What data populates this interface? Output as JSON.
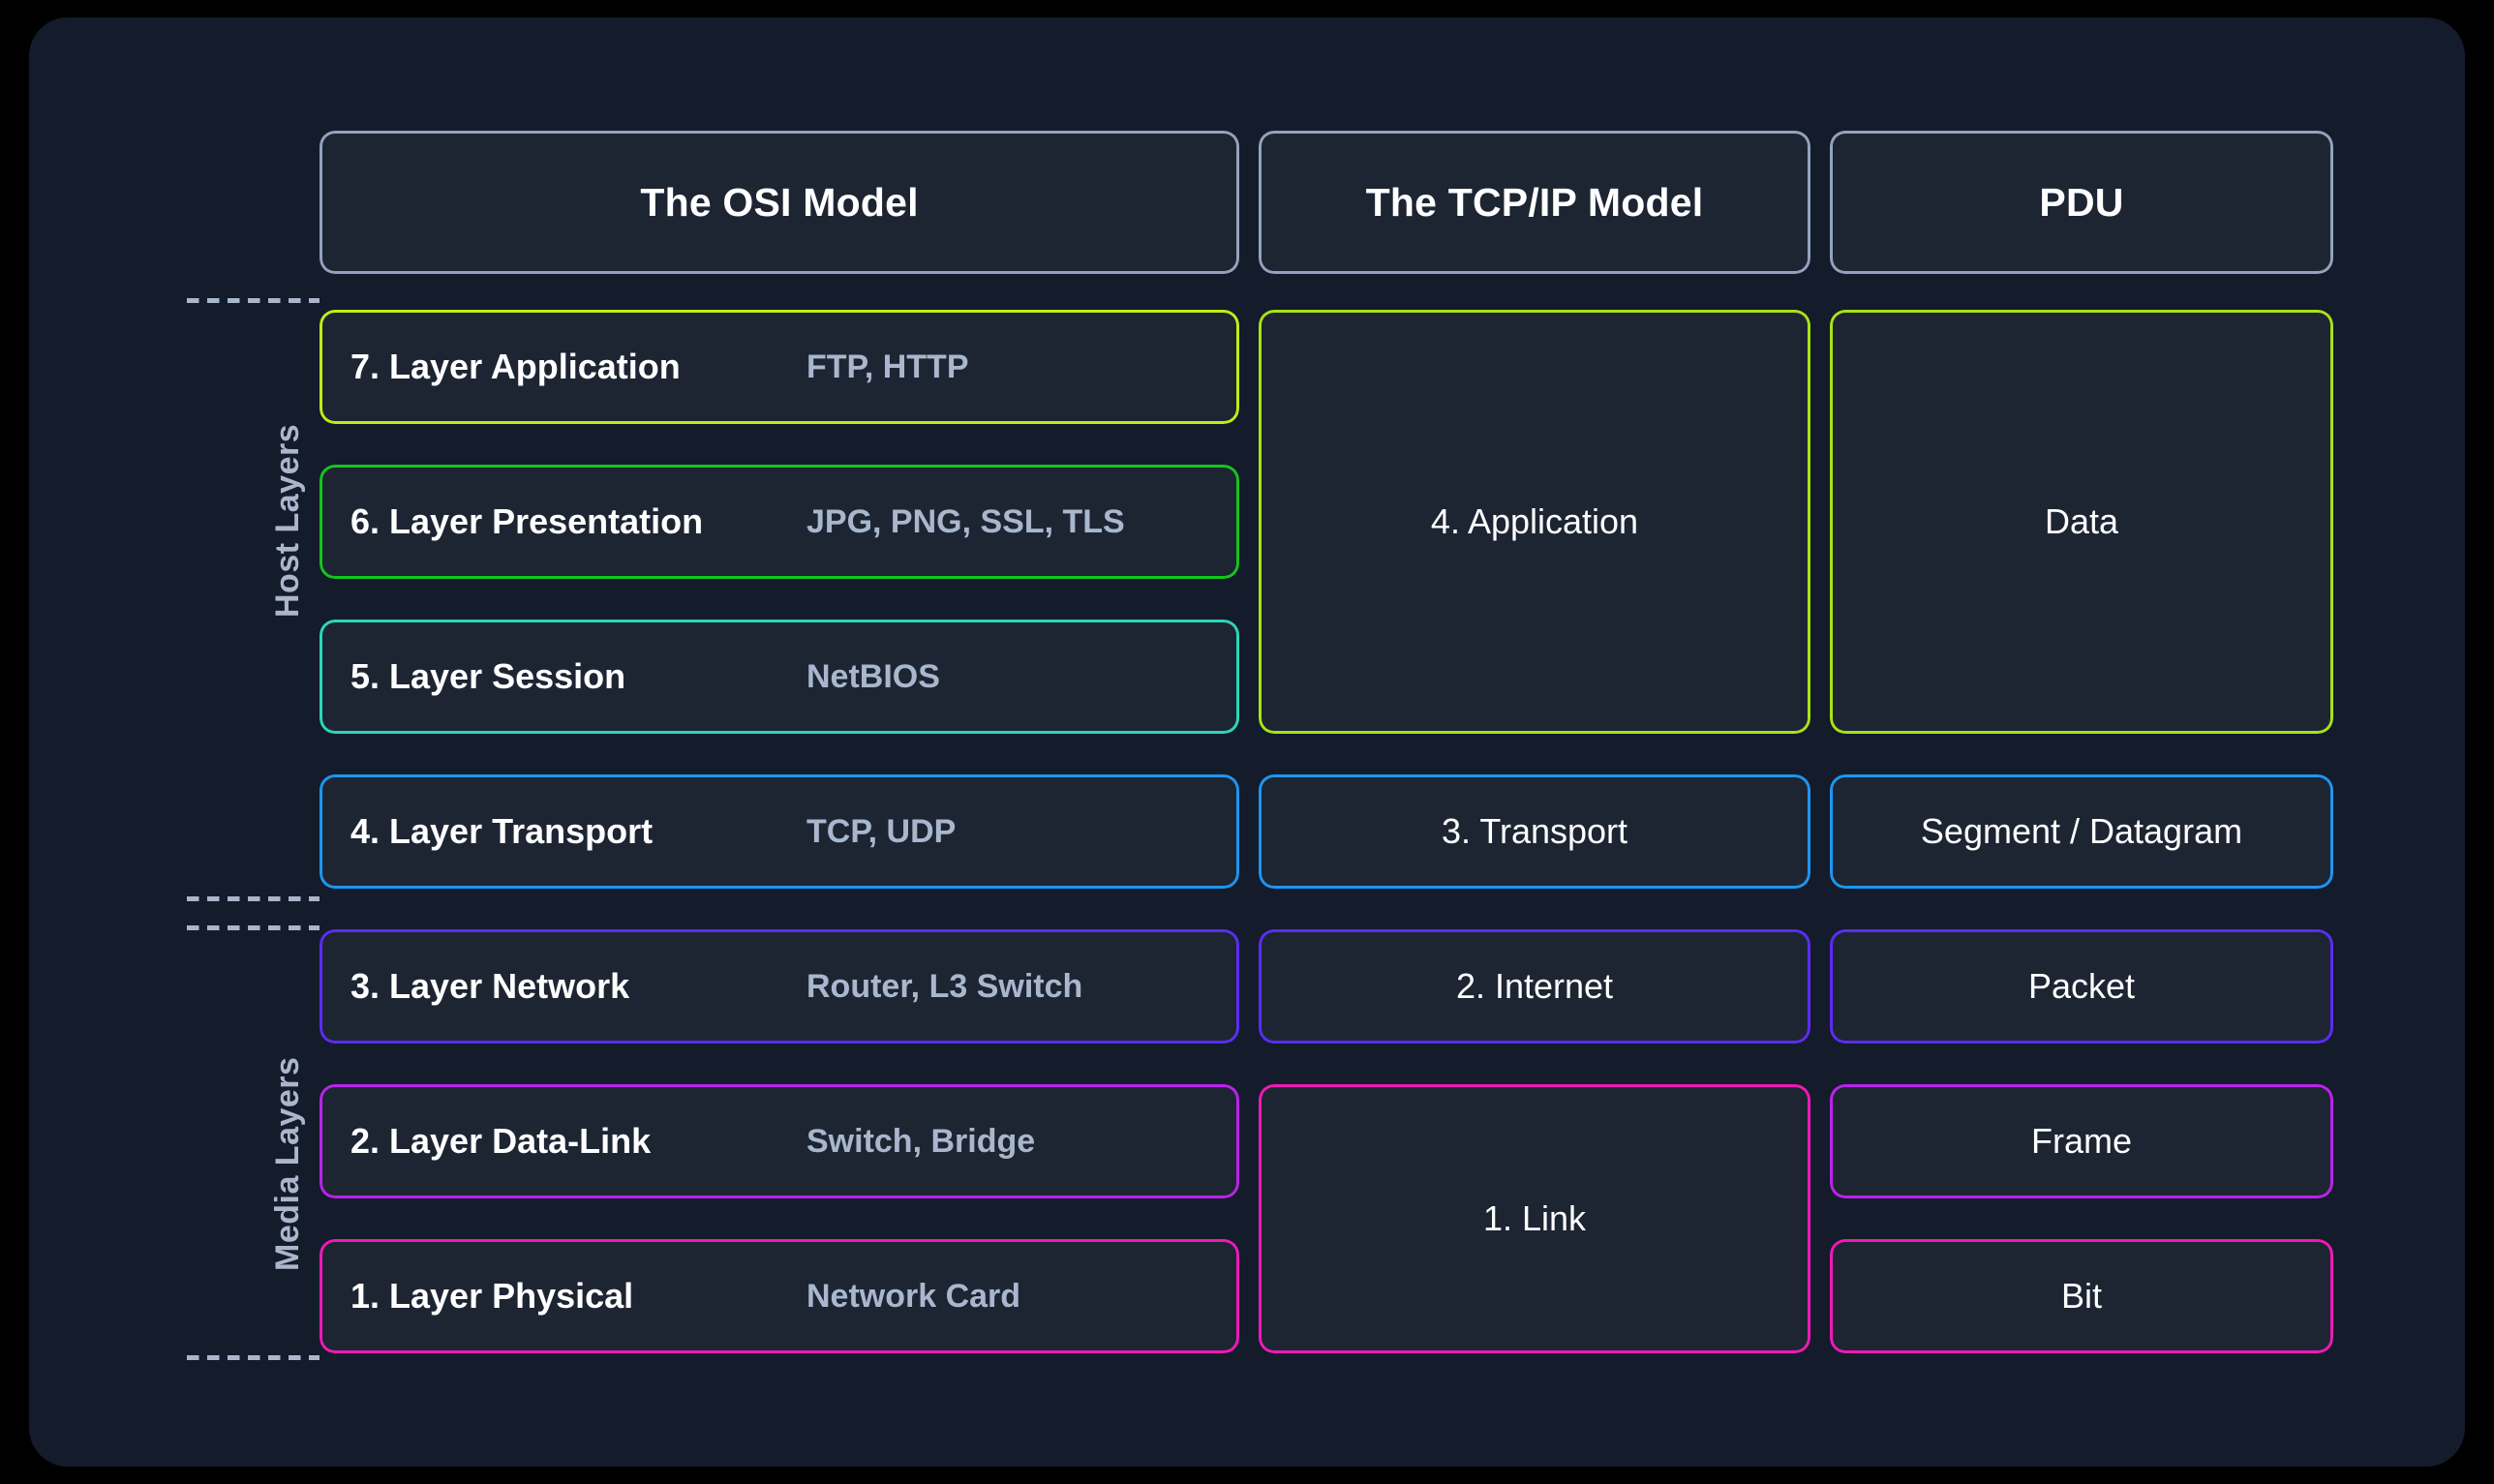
{
  "canvas": {
    "background": "#141b2b",
    "page_background": "#000000"
  },
  "headers": [
    {
      "id": "osi",
      "label": "The OSI Model",
      "border_color": "#93a2bd"
    },
    {
      "id": "tcpip",
      "label": "The TCP/IP Model",
      "border_color": "#93a2bd"
    },
    {
      "id": "pdu",
      "label": "PDU",
      "border_color": "#93a2bd"
    }
  ],
  "osi_layers": [
    {
      "number": "7.",
      "name": "7. Layer Application",
      "protocols": "FTP, HTTP",
      "border_color": "#c3ec15"
    },
    {
      "number": "6.",
      "name": "6. Layer Presentation",
      "protocols": "JPG, PNG, SSL, TLS",
      "border_color": "#13c61c"
    },
    {
      "number": "5.",
      "name": "5. Layer Session",
      "protocols": "NetBIOS",
      "border_color": "#2ad8b8"
    },
    {
      "number": "4.",
      "name": "4. Layer Transport",
      "protocols": "TCP, UDP",
      "border_color": "#1d96f0"
    },
    {
      "number": "3.",
      "name": "3. Layer Network",
      "protocols": "Router, L3 Switch",
      "border_color": "#5b2cf5"
    },
    {
      "number": "2.",
      "name": "2. Layer Data-Link",
      "protocols": "Switch, Bridge",
      "border_color": "#bb22ed"
    },
    {
      "number": "1.",
      "name": "1. Layer Physical",
      "protocols": "Network Card",
      "border_color": "#ef19b6"
    }
  ],
  "tcpip_layers": [
    {
      "label": "4. Application",
      "spans_osi": [
        7,
        6,
        5
      ],
      "border_color": "#a8e215"
    },
    {
      "label": "3. Transport",
      "spans_osi": [
        4
      ],
      "border_color": "#1d96f0"
    },
    {
      "label": "2. Internet",
      "spans_osi": [
        3
      ],
      "border_color": "#5b2cf5"
    },
    {
      "label": "1. Link",
      "spans_osi": [
        2,
        1
      ],
      "border_color": "#ef19b6"
    }
  ],
  "pdu_units": [
    {
      "label": "Data",
      "spans_osi": [
        7,
        6,
        5
      ],
      "border_color": "#a8e215"
    },
    {
      "label": "Segment / Datagram",
      "spans_osi": [
        4
      ],
      "border_color": "#1d96f0"
    },
    {
      "label": "Packet",
      "spans_osi": [
        3
      ],
      "border_color": "#5b2cf5"
    },
    {
      "label": "Frame",
      "spans_osi": [
        2
      ],
      "border_color": "#bb22ed"
    },
    {
      "label": "Bit",
      "spans_osi": [
        1
      ],
      "border_color": "#ef19b6"
    }
  ],
  "group_labels": [
    {
      "id": "host",
      "label": "Host Layers",
      "covers": [
        7,
        6,
        5
      ]
    },
    {
      "id": "media",
      "label": "Media Layers",
      "covers": [
        3,
        2,
        1
      ]
    }
  ],
  "separators": {
    "color": "#aab6cb",
    "count": 4
  }
}
